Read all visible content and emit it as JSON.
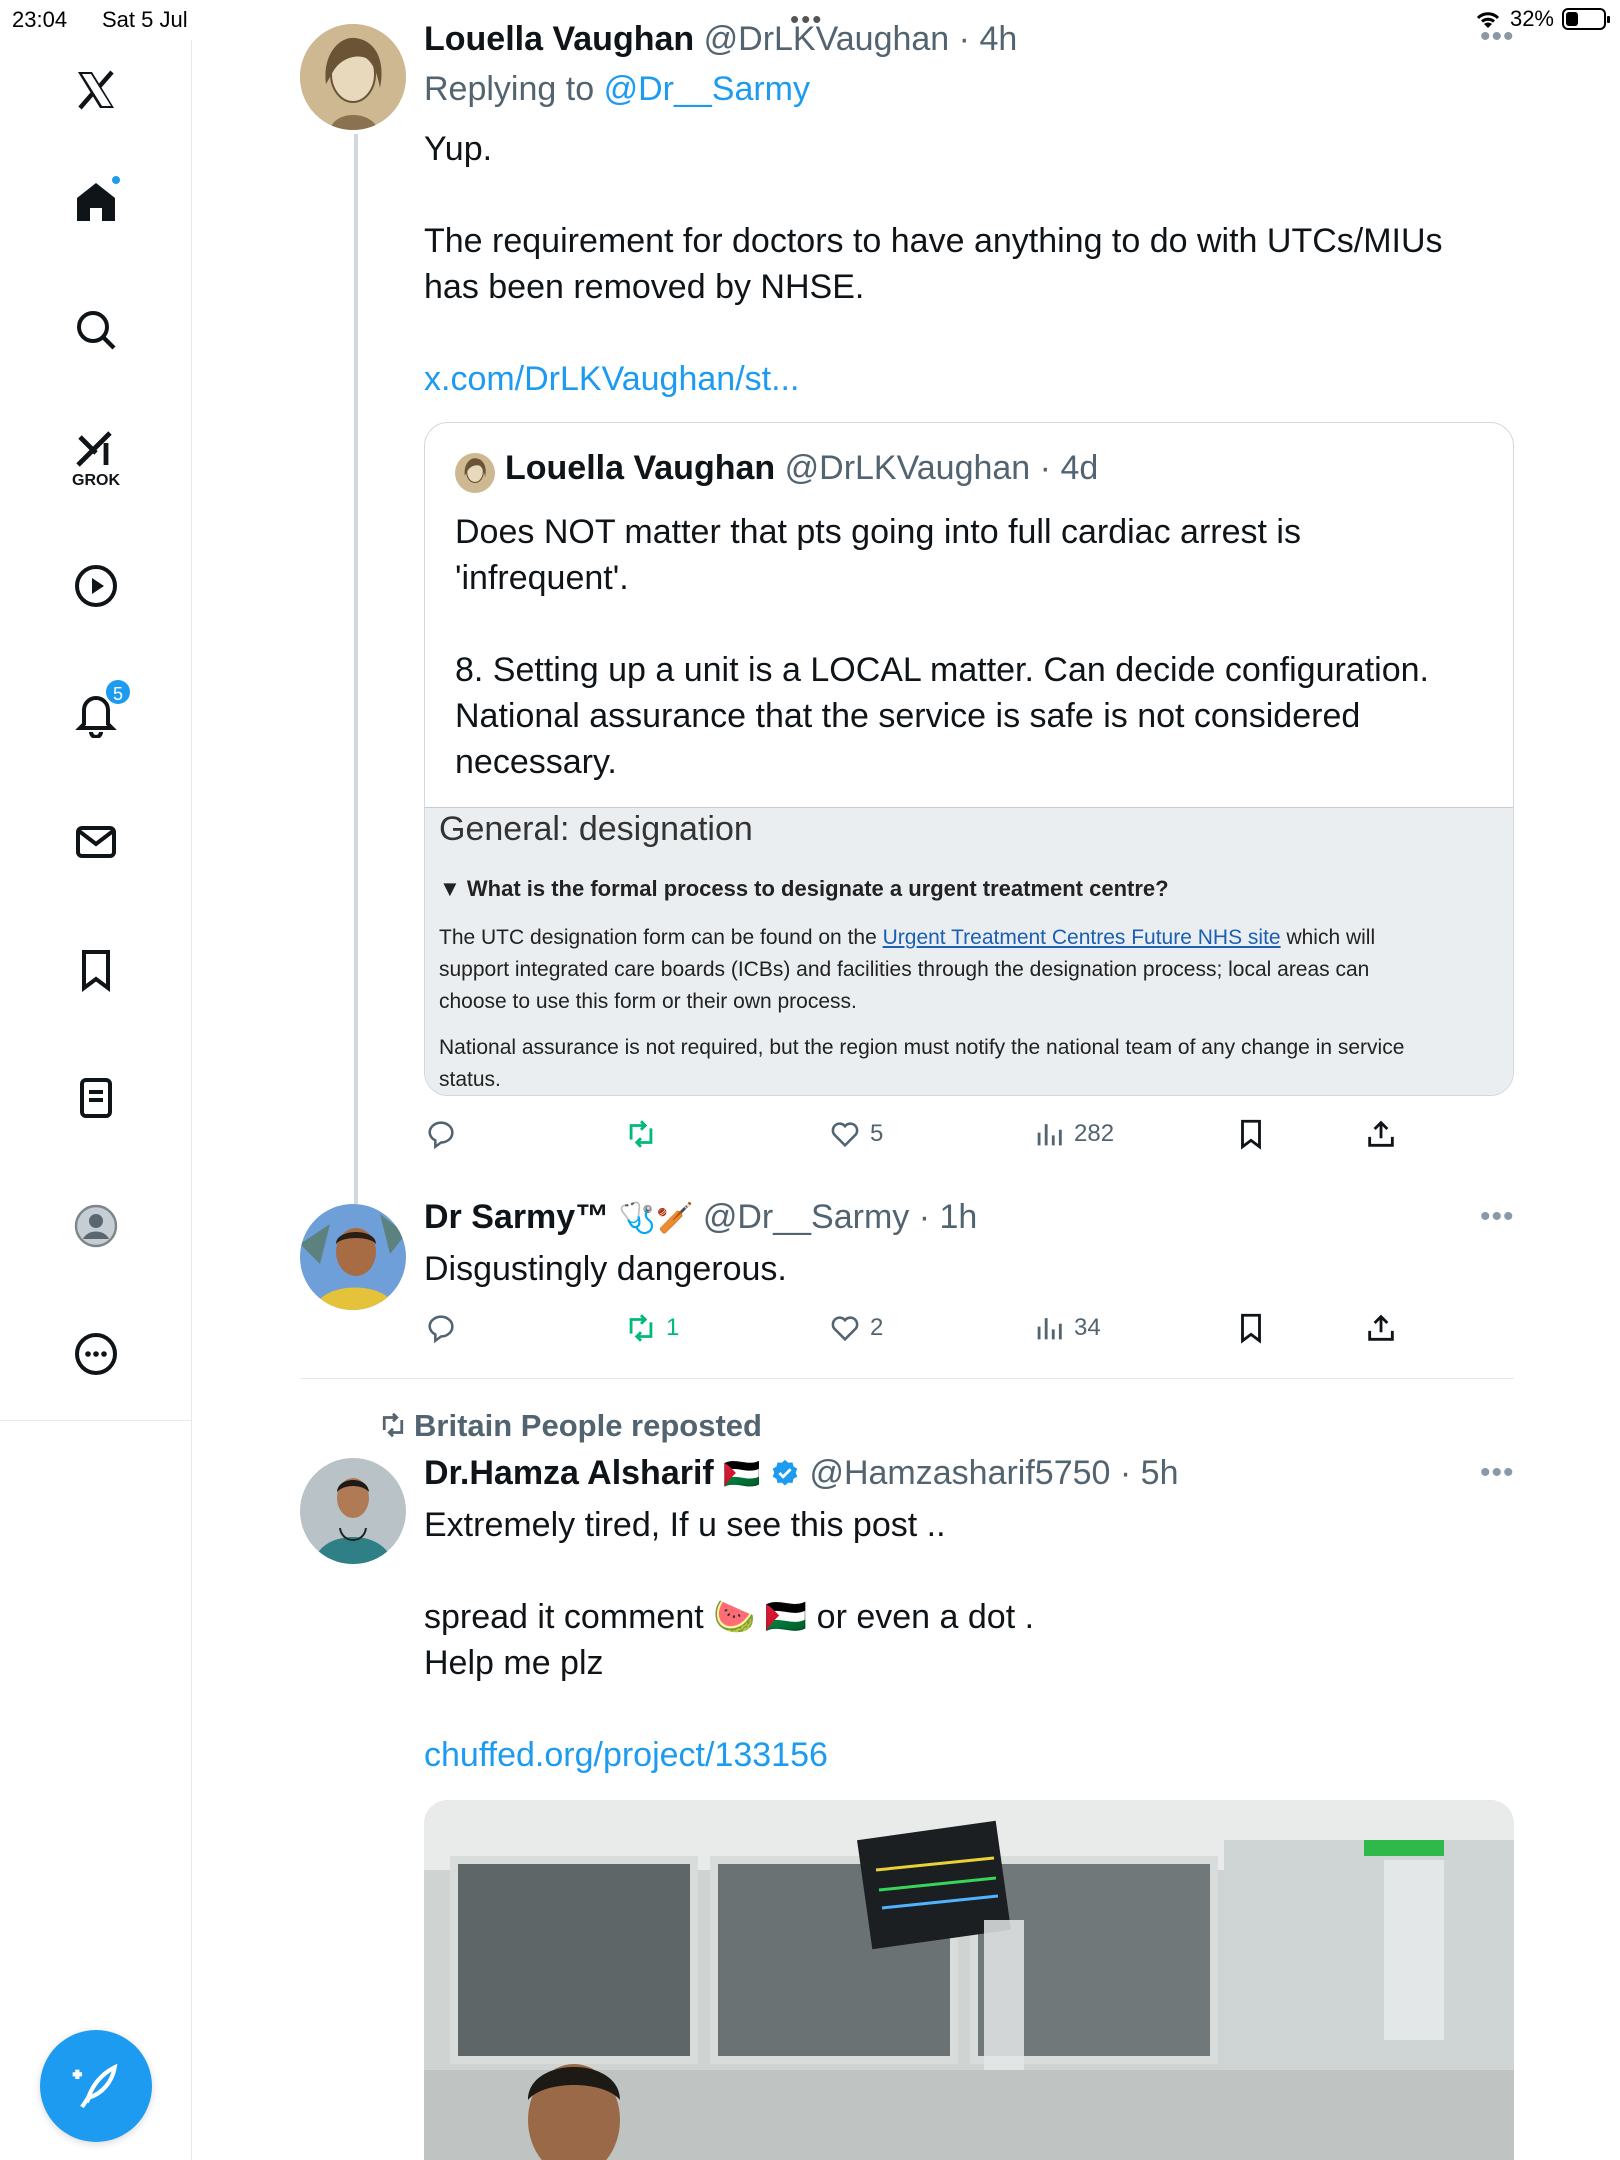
{
  "status_bar": {
    "time": "23:04",
    "date": "Sat 5 Jul",
    "battery": "32%",
    "battery_level": 0.32
  },
  "nav": {
    "grok_label": "GROK",
    "notifications_count": "5"
  },
  "tweets": [
    {
      "display_name": "Louella Vaughan",
      "handle": "@DrLKVaughan",
      "time": "4h",
      "replying_prefix": "Replying to",
      "replying_to": "@Dr__Sarmy",
      "text_lines": [
        "Yup.",
        "",
        "The requirement for doctors to have anything to do with UTCs/MIUs",
        "has been removed by NHSE.",
        "",
        "x.com/DrLKVaughan/st..."
      ],
      "link": "x.com/DrLKVaughan/st...",
      "quote": {
        "display_name": "Louella Vaughan",
        "handle": "@DrLKVaughan",
        "time": "4d",
        "lines": [
          "Does NOT matter that pts going into full cardiac arrest is",
          "'infrequent'.",
          "",
          "8. Setting up a unit is a LOCAL matter. Can decide configuration.",
          "National assurance that the service is safe is not considered",
          "necessary."
        ],
        "image": {
          "heading": "General: designation",
          "question": "What is the formal process to designate a urgent treatment centre?",
          "para1_before": "The UTC designation form can be found on the ",
          "para1_link": "Urgent Treatment Centres Future NHS site",
          "para1_after": " which will",
          "para1_line2": "support integrated care boards (ICBs) and facilities through the designation process; local areas can",
          "para1_line3": "choose to use this form or their own process.",
          "para2_line1": "National assurance is not required, but the region must notify the national team of any change in service",
          "para2_line2": "status."
        }
      },
      "actions": {
        "reply": "",
        "repost": "",
        "like": "5",
        "views": "282"
      }
    },
    {
      "display_name": "Dr Sarmy™",
      "emoji": "🩺🏏",
      "handle": "@Dr__Sarmy",
      "time": "1h",
      "text": "Disgustingly dangerous.",
      "actions": {
        "reply": "",
        "repost": "1",
        "like": "2",
        "views": "34"
      }
    },
    {
      "repost_label": "Britain People reposted",
      "display_name": "Dr.Hamza Alsharif",
      "flag": "🇵🇸",
      "handle": "@Hamzasharif5750",
      "time": "5h",
      "text_lines": [
        "Extremely tired, If u see this post ..",
        "",
        "spread it comment 🍉 🇵🇸 or even a dot .",
        "Help me plz",
        "",
        "chuffed.org/project/133156"
      ],
      "link": "chuffed.org/project/133156"
    }
  ],
  "colors": {
    "accent": "#1d9bf0",
    "repost_green": "#00ba7c",
    "secondary_text": "#536471",
    "divider": "#e6e9ec"
  }
}
